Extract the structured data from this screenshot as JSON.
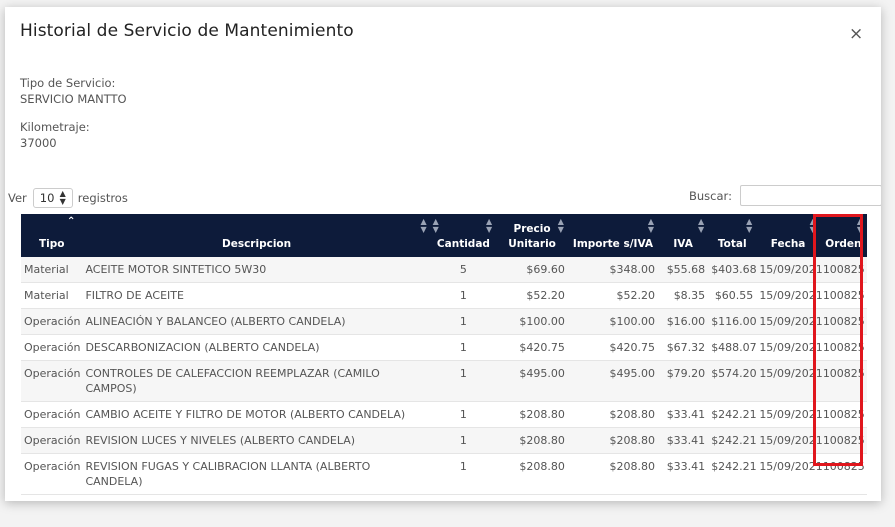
{
  "modal": {
    "title": "Historial de Servicio de Mantenimiento",
    "close_label": "×"
  },
  "info": {
    "tipo_label": "Tipo de Servicio:",
    "tipo_value": "SERVICIO MANTTO",
    "km_label": "Kilometraje:",
    "km_value": "37000"
  },
  "controls": {
    "ver_label": "Ver",
    "page_size": "10",
    "registros_label": "registros",
    "buscar_label": "Buscar:",
    "search_value": ""
  },
  "table": {
    "headers": {
      "tipo": "Tipo",
      "descripcion": "Descripcion",
      "cantidad": "Cantidad",
      "precio": "Precio Unitario",
      "importe": "Importe s/IVA",
      "iva": "IVA",
      "total": "Total",
      "fecha": "Fecha",
      "orden": "Orden"
    },
    "rows": [
      {
        "tipo": "Material",
        "descripcion": "ACEITE MOTOR SINTETICO 5W30",
        "cantidad": "5",
        "precio": "$69.60",
        "importe": "$348.00",
        "iva": "$55.68",
        "total": "$403.68",
        "fecha": "15/09/2021",
        "orden": "100825"
      },
      {
        "tipo": "Material",
        "descripcion": "FILTRO DE ACEITE",
        "cantidad": "1",
        "precio": "$52.20",
        "importe": "$52.20",
        "iva": "$8.35",
        "total": "$60.55",
        "fecha": "15/09/2021",
        "orden": "100825"
      },
      {
        "tipo": "Operación",
        "descripcion": "ALINEACIÓN Y BALANCEO (ALBERTO CANDELA)",
        "cantidad": "1",
        "precio": "$100.00",
        "importe": "$100.00",
        "iva": "$16.00",
        "total": "$116.00",
        "fecha": "15/09/2021",
        "orden": "100825"
      },
      {
        "tipo": "Operación",
        "descripcion": "DESCARBONIZACION (ALBERTO CANDELA)",
        "cantidad": "1",
        "precio": "$420.75",
        "importe": "$420.75",
        "iva": "$67.32",
        "total": "$488.07",
        "fecha": "15/09/2021",
        "orden": "100825"
      },
      {
        "tipo": "Operación",
        "descripcion": "CONTROLES DE CALEFACCION REEMPLAZAR (CAMILO CAMPOS)",
        "cantidad": "1",
        "precio": "$495.00",
        "importe": "$495.00",
        "iva": "$79.20",
        "total": "$574.20",
        "fecha": "15/09/2021",
        "orden": "100825"
      },
      {
        "tipo": "Operación",
        "descripcion": "CAMBIO ACEITE Y FILTRO DE MOTOR (ALBERTO CANDELA)",
        "cantidad": "1",
        "precio": "$208.80",
        "importe": "$208.80",
        "iva": "$33.41",
        "total": "$242.21",
        "fecha": "15/09/2021",
        "orden": "100825"
      },
      {
        "tipo": "Operación",
        "descripcion": "REVISION LUCES Y NIVELES (ALBERTO CANDELA)",
        "cantidad": "1",
        "precio": "$208.80",
        "importe": "$208.80",
        "iva": "$33.41",
        "total": "$242.21",
        "fecha": "15/09/2021",
        "orden": "100825"
      },
      {
        "tipo": "Operación",
        "descripcion": "REVISION FUGAS Y CALIBRACION LLANTA (ALBERTO CANDELA)",
        "cantidad": "1",
        "precio": "$208.80",
        "importe": "$208.80",
        "iva": "$33.41",
        "total": "$242.21",
        "fecha": "15/09/2021",
        "orden": "100825"
      }
    ]
  },
  "colors": {
    "header_bg": "#0d1b3a",
    "highlight": "#e0161d"
  },
  "icons": {
    "sort": "sort-icon",
    "sort_up": "sort-up-icon",
    "close": "close-icon",
    "select_arrows": "select-arrows-icon"
  }
}
